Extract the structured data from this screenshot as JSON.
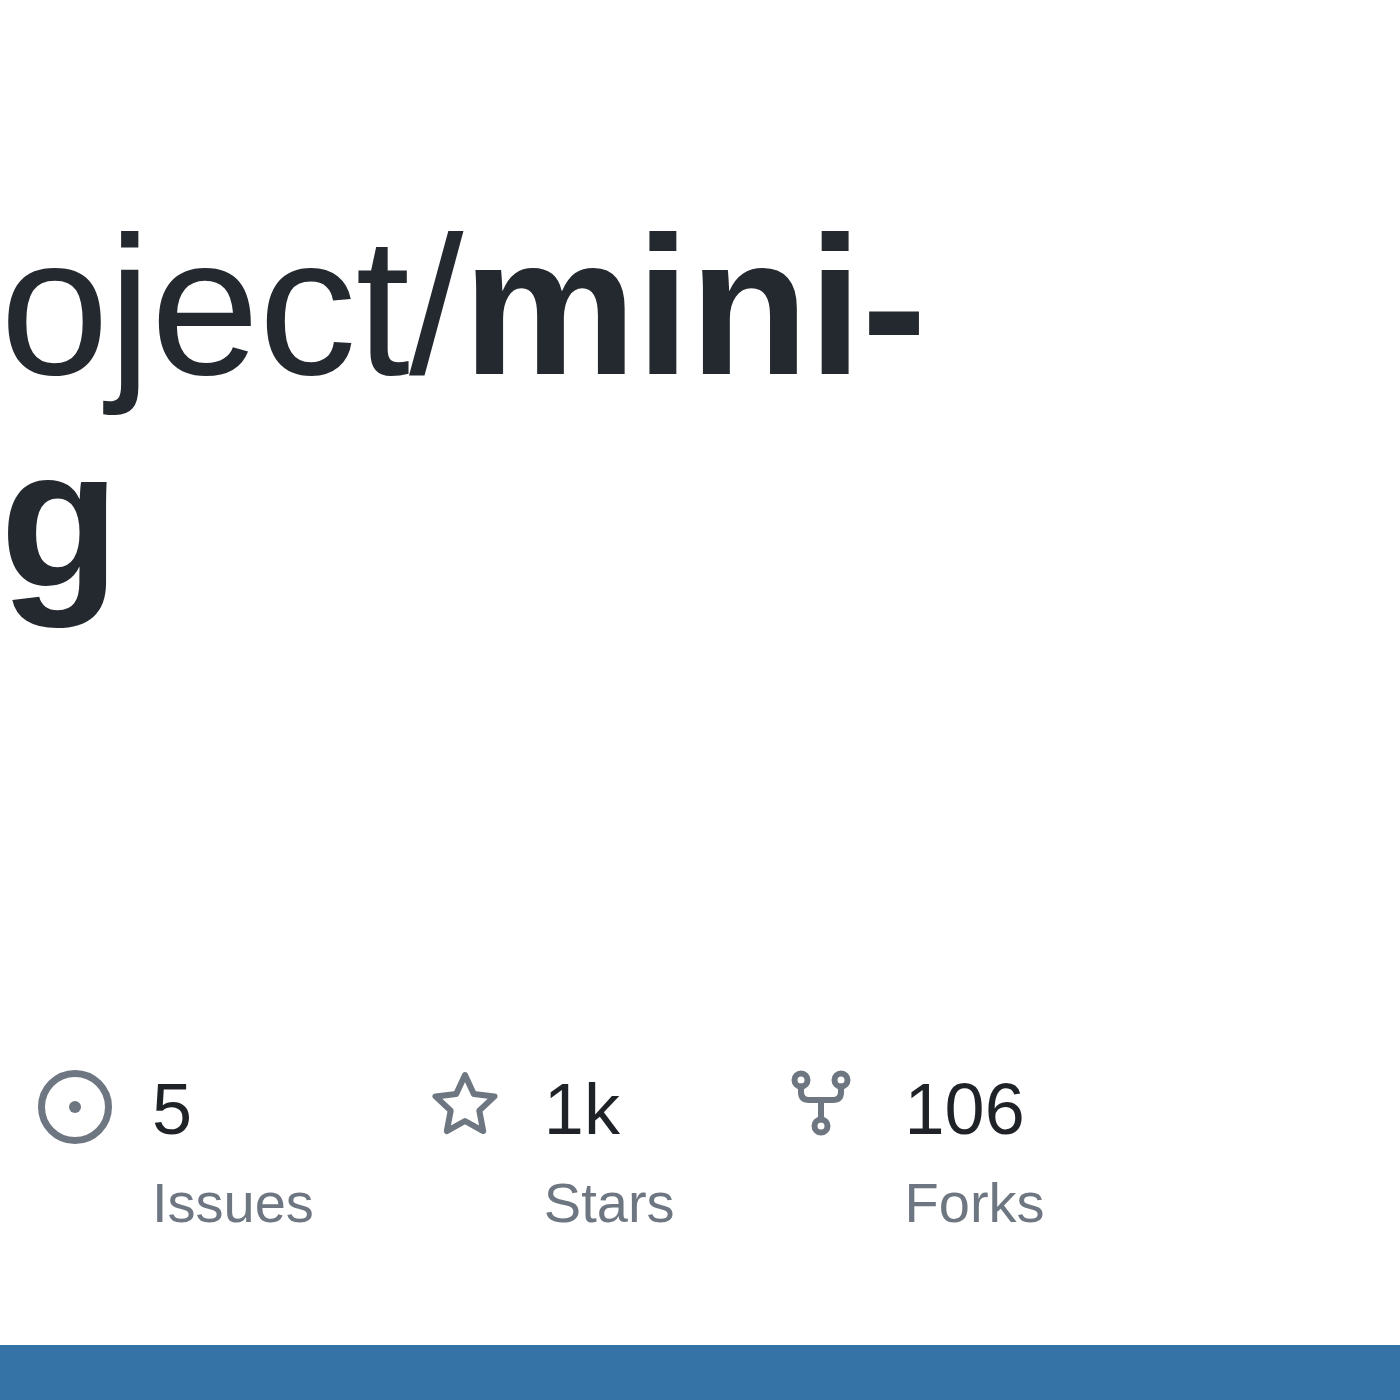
{
  "title": {
    "owner": "oject/",
    "name_lines": [
      "mini-",
      "g"
    ]
  },
  "stats": [
    {
      "kind": "issues",
      "count": "5",
      "label": "Issues"
    },
    {
      "kind": "stars",
      "count": "1k",
      "label": "Stars"
    },
    {
      "kind": "forks",
      "count": "106",
      "label": "Forks"
    }
  ],
  "languages": [
    {
      "color": "#3572a5"
    }
  ]
}
